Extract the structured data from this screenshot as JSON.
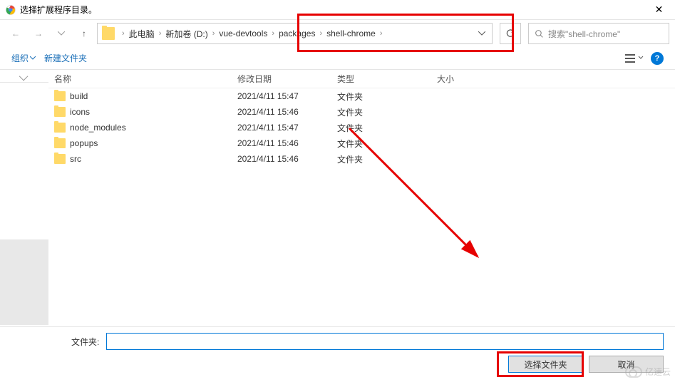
{
  "titlebar": {
    "title": "选择扩展程序目录。"
  },
  "breadcrumb": {
    "items": [
      "此电脑",
      "新加卷 (D:)",
      "vue-devtools",
      "packages",
      "shell-chrome"
    ]
  },
  "search": {
    "placeholder": "搜索\"shell-chrome\""
  },
  "toolbar": {
    "organize": "组织",
    "new_folder": "新建文件夹"
  },
  "columns": {
    "name": "名称",
    "modified": "修改日期",
    "type": "类型",
    "size": "大小"
  },
  "files": [
    {
      "name": "build",
      "modified": "2021/4/11 15:47",
      "type": "文件夹"
    },
    {
      "name": "icons",
      "modified": "2021/4/11 15:46",
      "type": "文件夹"
    },
    {
      "name": "node_modules",
      "modified": "2021/4/11 15:47",
      "type": "文件夹"
    },
    {
      "name": "popups",
      "modified": "2021/4/11 15:46",
      "type": "文件夹"
    },
    {
      "name": "src",
      "modified": "2021/4/11 15:46",
      "type": "文件夹"
    }
  ],
  "footer": {
    "folder_label": "文件夹:",
    "folder_value": "",
    "select_btn": "选择文件夹",
    "cancel_btn": "取消"
  },
  "watermark": "亿速云"
}
